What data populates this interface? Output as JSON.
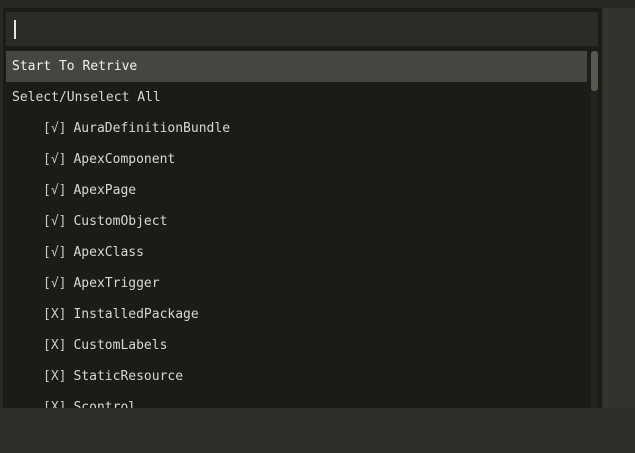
{
  "search": {
    "value": ""
  },
  "list": {
    "actions": [
      {
        "label": "Start To Retrive"
      },
      {
        "label": "Select/Unselect All"
      }
    ],
    "items": [
      {
        "mark": "[√]",
        "label": "AuraDefinitionBundle"
      },
      {
        "mark": "[√]",
        "label": "ApexComponent"
      },
      {
        "mark": "[√]",
        "label": "ApexPage"
      },
      {
        "mark": "[√]",
        "label": "CustomObject"
      },
      {
        "mark": "[√]",
        "label": "ApexClass"
      },
      {
        "mark": "[√]",
        "label": "ApexTrigger"
      },
      {
        "mark": "[X]",
        "label": "InstalledPackage"
      },
      {
        "mark": "[X]",
        "label": "CustomLabels"
      },
      {
        "mark": "[X]",
        "label": "StaticResource"
      },
      {
        "mark": "[X]",
        "label": "Scontrol"
      }
    ]
  },
  "colors": {
    "background": "#272822",
    "panel": "#1b1c18",
    "selected_row": "#454640",
    "text": "#d8d8d0"
  }
}
